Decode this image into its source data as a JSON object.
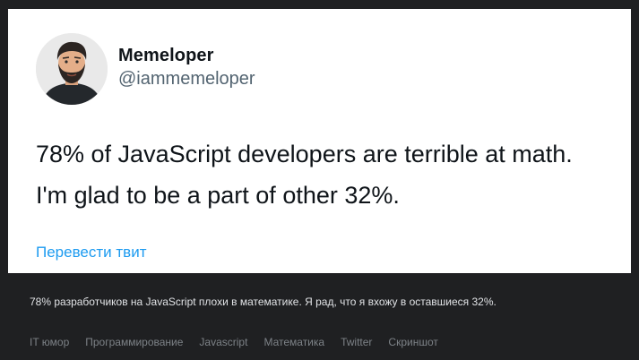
{
  "tweet": {
    "user_name": "Memeloper",
    "user_handle": "@iammemeloper",
    "text_lines": [
      "78% of JavaScript developers are terrible at math.",
      "I'm glad to be a part of other 32%."
    ],
    "translate_label": "Перевести твит"
  },
  "post": {
    "caption": "78% разработчиков на JavaScript плохи в математике. Я рад, что я вхожу в оставшиеся 32%.",
    "tags": [
      "IT юмор",
      "Программирование",
      "Javascript",
      "Математика",
      "Twitter",
      "Скриншот"
    ]
  },
  "colors": {
    "card_background": "#ffffff",
    "page_background": "#1f2022",
    "link": "#1d9bf0",
    "handle": "#536471"
  },
  "icons": {
    "avatar": "bearded-man-avatar"
  }
}
